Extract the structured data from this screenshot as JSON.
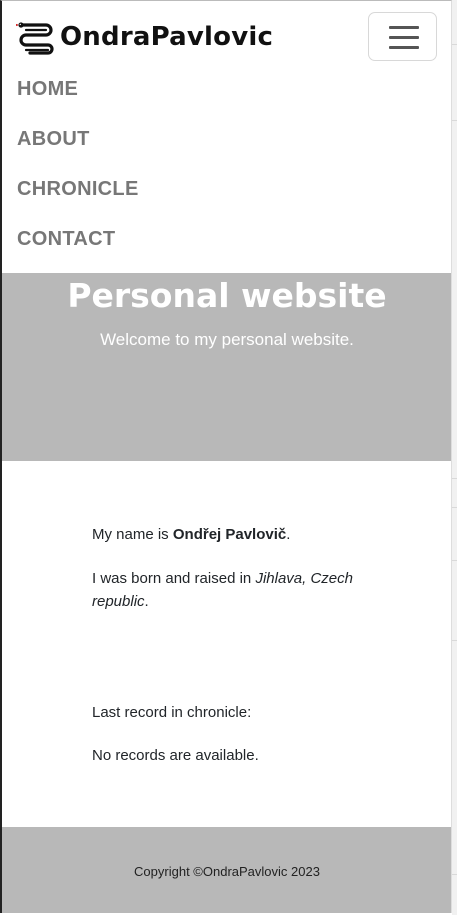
{
  "brand": {
    "name": "OndraPavlovic",
    "icon": "snake-logo-icon"
  },
  "nav": {
    "toggle_icon": "hamburger-icon",
    "items": [
      {
        "label": "HOME"
      },
      {
        "label": "ABOUT"
      },
      {
        "label": "CHRONICLE"
      },
      {
        "label": "CONTACT"
      }
    ]
  },
  "hero": {
    "title": "Personal website",
    "subtitle": "Welcome to my personal website."
  },
  "about": {
    "intro_prefix": "My name is ",
    "name": "Ondřej Pavlovič",
    "intro_suffix": ".",
    "born_prefix": "I was born and raised in ",
    "born_place": "Jihlava, Czech republic",
    "born_suffix": "."
  },
  "chronicle": {
    "heading": "Last record in chronicle:",
    "empty_message": "No records are available."
  },
  "footer": {
    "copyright": "Copyright ©OndraPavlovic 2023"
  },
  "colors": {
    "hero_bg": "#b8b8b8",
    "footer_bg": "#b8b8b8",
    "nav_text": "#777777"
  }
}
